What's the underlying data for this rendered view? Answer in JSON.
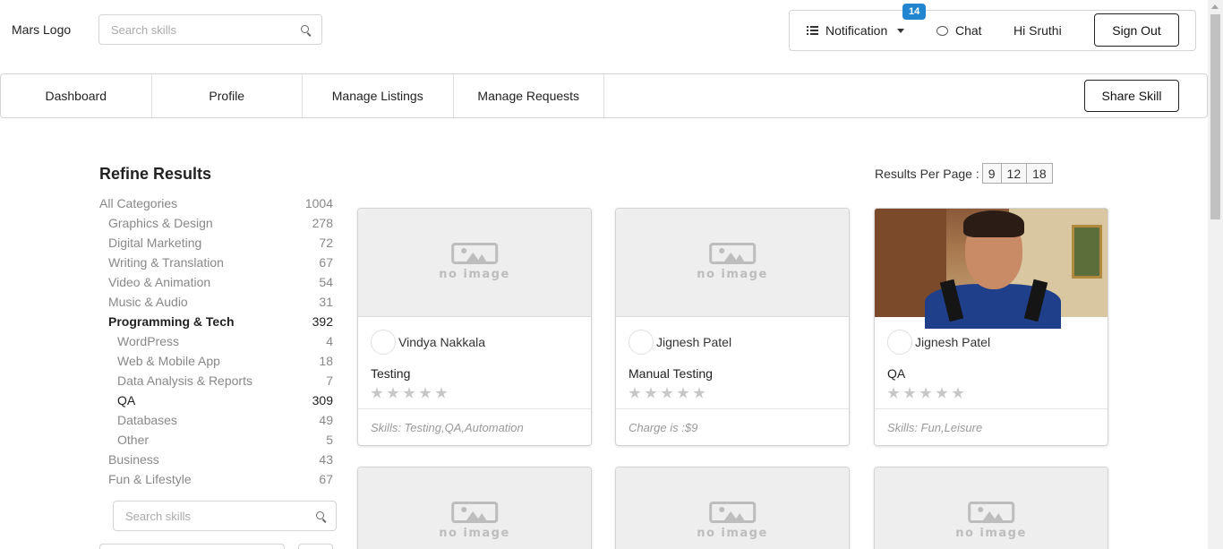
{
  "header": {
    "logo": "Mars Logo",
    "search_placeholder": "Search skills",
    "notification_label": "Notification",
    "notification_count": "14",
    "chat_label": "Chat",
    "greeting": "Hi Sruthi",
    "signout_label": "Sign Out"
  },
  "nav": {
    "tabs": [
      {
        "label": "Dashboard"
      },
      {
        "label": "Profile"
      },
      {
        "label": "Manage Listings"
      },
      {
        "label": "Manage Requests"
      }
    ],
    "share_label": "Share Skill"
  },
  "sidebar": {
    "title": "Refine Results",
    "categories": [
      {
        "label": "All Categories",
        "count": "1004"
      },
      {
        "label": "Graphics & Design",
        "count": "278"
      },
      {
        "label": "Digital Marketing",
        "count": "72"
      },
      {
        "label": "Writing & Translation",
        "count": "67"
      },
      {
        "label": "Video & Animation",
        "count": "54"
      },
      {
        "label": "Music & Audio",
        "count": "31"
      },
      {
        "label": "Programming & Tech",
        "count": "392"
      },
      {
        "label": "WordPress",
        "count": "4"
      },
      {
        "label": "Web & Mobile App",
        "count": "18"
      },
      {
        "label": "Data Analysis & Reports",
        "count": "7"
      },
      {
        "label": "QA",
        "count": "309"
      },
      {
        "label": "Databases",
        "count": "49"
      },
      {
        "label": "Other",
        "count": "5"
      },
      {
        "label": "Business",
        "count": "43"
      },
      {
        "label": "Fun & Lifestyle",
        "count": "67"
      }
    ],
    "search_placeholder": "Search skills"
  },
  "results_per_page": {
    "label": "Results Per Page :",
    "options": [
      "9",
      "12",
      "18"
    ]
  },
  "cards": [
    {
      "seller": "Vindya Nakkala",
      "title": "Testing",
      "footer": "Skills: Testing,QA,Automation",
      "image": "no image"
    },
    {
      "seller": "Jignesh Patel",
      "title": "Manual Testing",
      "footer": "Charge is :$9",
      "image": "no image"
    },
    {
      "seller": "Jignesh Patel",
      "title": "QA",
      "footer": "Skills: Fun,Leisure"
    },
    {
      "image": "no image"
    },
    {
      "image": "no image"
    },
    {
      "image": "no image"
    }
  ],
  "colors": {
    "badge": "#2185d0",
    "border": "#d4d4d5",
    "placeholder_bg": "#eeeeee",
    "star": "#c7c7c7"
  }
}
